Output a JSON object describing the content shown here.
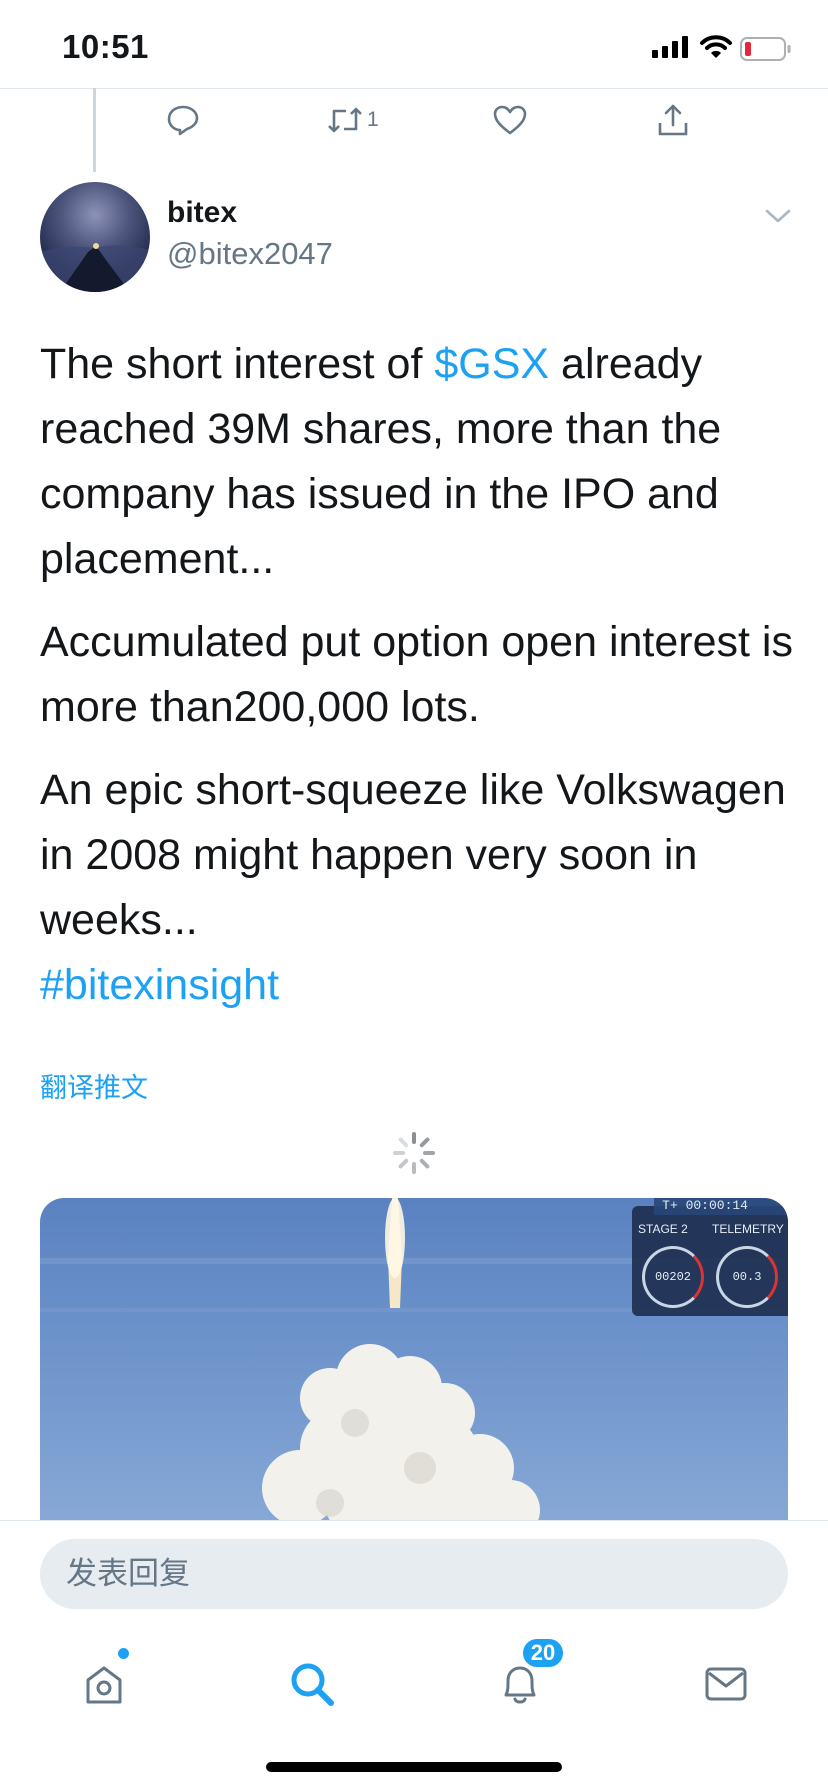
{
  "status_bar": {
    "time": "10:51"
  },
  "previous_tweet": {
    "retweet_count": "1"
  },
  "tweet": {
    "display_name": "bitex",
    "handle": "@bitex2047",
    "paragraph1": {
      "before": "The short interest of ",
      "cashtag": "$GSX",
      "after": " already reached 39M shares, more than the company has issued in the IPO and placement..."
    },
    "paragraph2": "Accumulated put option open interest is more than200,000 lots.",
    "paragraph3": "An epic short-squeeze like Volkswagen in 2008 might happen very soon in weeks...",
    "hashtag": "#bitexinsight",
    "translate_label": "翻译推文"
  },
  "media": {
    "timer": "T+ 00:00:14",
    "stage_label": "STAGE 2",
    "telemetry_label": "TELEMETRY",
    "speed_value": "00202",
    "altitude_value": "00.3"
  },
  "reply": {
    "placeholder": "发表回复"
  },
  "tab_bar": {
    "notifications_badge": "20"
  },
  "colors": {
    "accent": "#1da1f2",
    "secondary_text": "#657786",
    "divider": "#e1e8ed",
    "battery_low": "#e0283e"
  },
  "icons": [
    "reply-icon",
    "retweet-icon",
    "like-icon",
    "share-icon",
    "chevron-down-icon",
    "home-icon",
    "search-icon",
    "bell-icon",
    "mail-icon",
    "spinner-icon"
  ]
}
